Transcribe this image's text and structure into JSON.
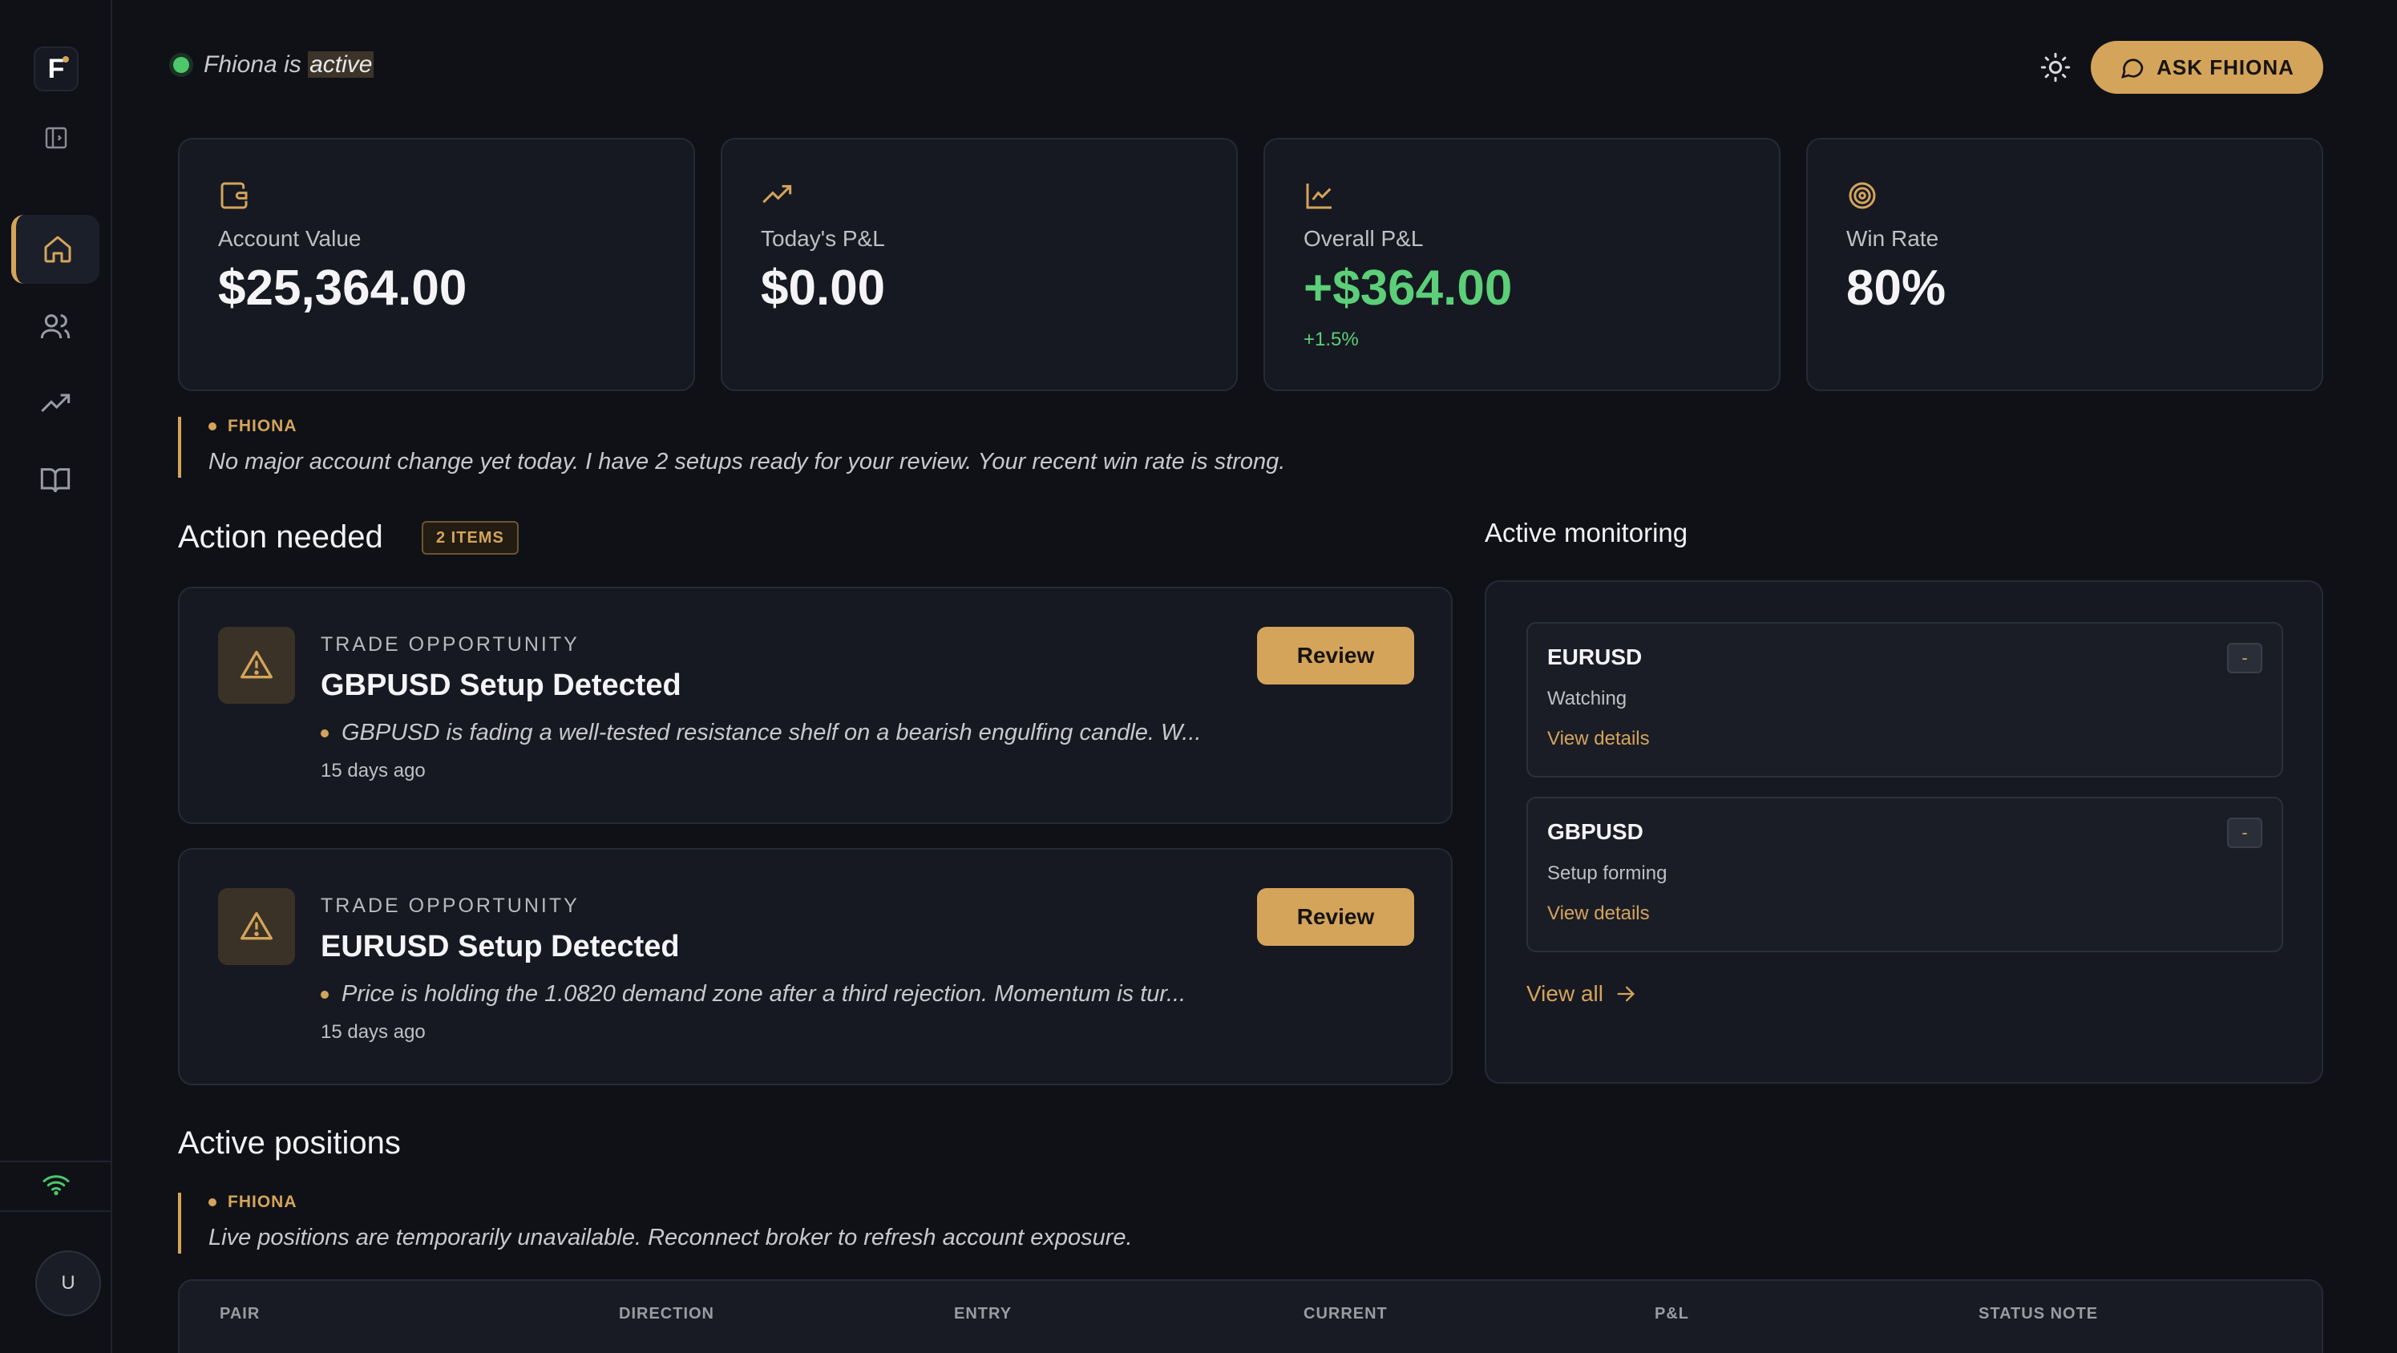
{
  "app": {
    "logo_letter": "F",
    "user_initial": "U",
    "accent": "#d4a45b",
    "positive": "#5ccf78"
  },
  "sidebar": {
    "items": [
      {
        "name": "home",
        "icon": "home-icon",
        "active": true
      },
      {
        "name": "users",
        "icon": "users-icon",
        "active": false
      },
      {
        "name": "trends",
        "icon": "trending-up-icon",
        "active": false
      },
      {
        "name": "journal",
        "icon": "book-icon",
        "active": false
      }
    ],
    "connection_icon": "wifi-icon"
  },
  "header": {
    "status_prefix": "Fhiona is",
    "status_word": "active",
    "theme_icon": "sun-icon",
    "ask_label": "ASK FHIONA"
  },
  "stats": [
    {
      "label": "Account Value",
      "value": "$25,364.00",
      "sub": "",
      "icon": "wallet-icon"
    },
    {
      "label": "Today's P&L",
      "value": "$0.00",
      "sub": "",
      "icon": "trending-up-icon"
    },
    {
      "label": "Overall P&L",
      "value": "+$364.00",
      "sub": "+1.5%",
      "icon": "line-chart-icon"
    },
    {
      "label": "Win Rate",
      "value": "80%",
      "sub": "",
      "icon": "target-icon"
    }
  ],
  "notes": [
    {
      "tag": "FHIONA",
      "text": "No major account change yet today. I have 2 setups ready for your review. Your recent win rate is strong."
    },
    {
      "tag": "FHIONA",
      "text": "Live positions are temporarily unavailable. Reconnect broker to refresh account exposure."
    }
  ],
  "action": {
    "title": "Action needed",
    "badge": "2 ITEMS",
    "items": [
      {
        "type": "TRADE OPPORTUNITY",
        "title": "GBPUSD Setup Detected",
        "description": "GBPUSD is fading a well-tested resistance shelf on a bearish engulfing candle. W...",
        "time": "15 days ago",
        "button": "Review"
      },
      {
        "type": "TRADE OPPORTUNITY",
        "title": "EURUSD Setup Detected",
        "description": "Price is holding the 1.0820 demand zone after a third rejection. Momentum is tur...",
        "time": "15 days ago",
        "button": "Review"
      }
    ]
  },
  "monitoring": {
    "title": "Active monitoring",
    "items": [
      {
        "pair": "EURUSD",
        "state": "Watching",
        "link": "View details",
        "collapse": "-"
      },
      {
        "pair": "GBPUSD",
        "state": "Setup forming",
        "link": "View details",
        "collapse": "-"
      }
    ],
    "view_all": "View all"
  },
  "positions": {
    "title": "Active positions",
    "columns": [
      "PAIR",
      "DIRECTION",
      "ENTRY",
      "CURRENT",
      "P&L",
      "STATUS NOTE"
    ]
  }
}
